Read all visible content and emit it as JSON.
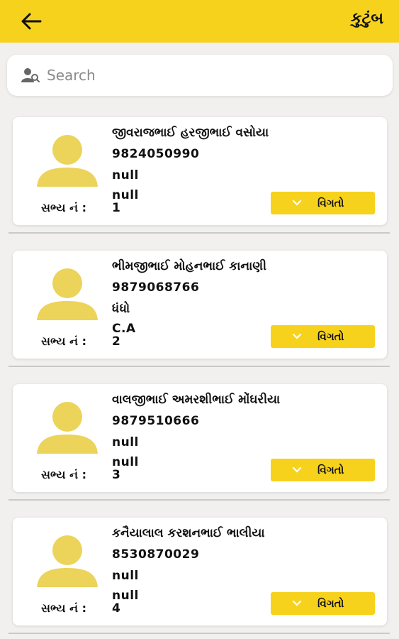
{
  "appbar": {
    "title": "કુટુંબ",
    "back_icon": "arrow-left-icon",
    "background": "#f7d21d"
  },
  "search": {
    "placeholder": "Search",
    "icon": "user-search-icon"
  },
  "members": [
    {
      "name": "જીવરાજભાઈ હરજીભાઈ વસોયા",
      "phone": "9824050990",
      "line3": "null",
      "line4": "null",
      "member_label": "સભ્ય નં :",
      "member_no": "1",
      "details_label": "વિગતો"
    },
    {
      "name": "ભીમજીભાઈ મોહનભાઈ કાનાણી",
      "phone": "9879068766",
      "line3": "ધંધો",
      "line4": "C.A",
      "member_label": "સભ્ય નં :",
      "member_no": "2",
      "details_label": "વિગતો"
    },
    {
      "name": "વાલજીભાઈ અમરશીભાઈ મોંઘરીયા",
      "phone": "9879510666",
      "line3": "null",
      "line4": "null",
      "member_label": "સભ્ય નં :",
      "member_no": "3",
      "details_label": "વિગતો"
    },
    {
      "name": "કનૈયાલાલ કરશનભાઈ ભાલીયા",
      "phone": "8530870029",
      "line3": "null",
      "line4": "null",
      "member_label": "સભ્ય નં :",
      "member_no": "4",
      "details_label": "વિગતો"
    }
  ],
  "colors": {
    "accent": "#f7d21d",
    "avatar": "#ecd35a",
    "background": "#f1f0ef"
  }
}
